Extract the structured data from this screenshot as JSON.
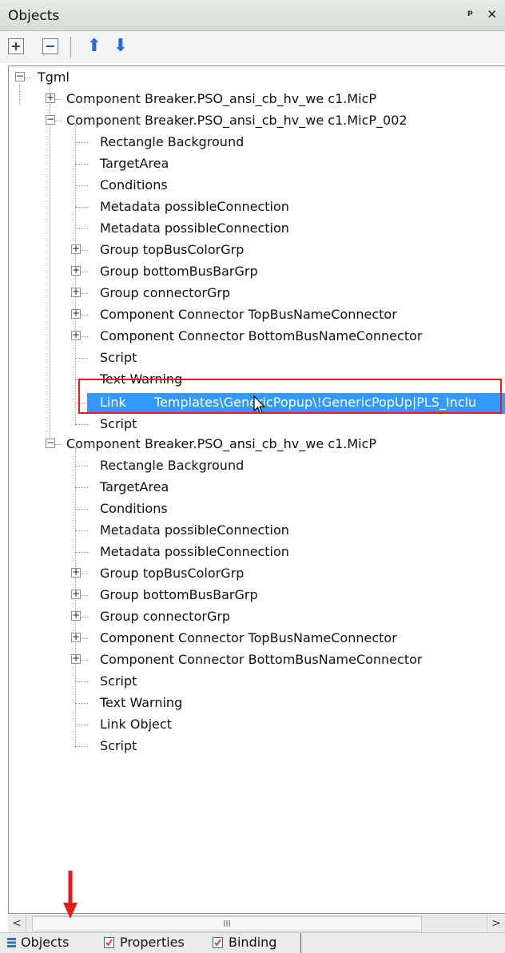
{
  "panel": {
    "title": "Objects",
    "buttons": "ᵖ ✕"
  },
  "toolbar": {
    "expand_all": "+",
    "collapse_all": "−",
    "move_up": "⬆",
    "move_down": "⬇"
  },
  "tree": {
    "root": "Tgml",
    "component1": "Component Breaker.PSO_ansi_cb_hv_we  c1.MicP",
    "component2": "Component Breaker.PSO_ansi_cb_hv_we  c1.MicP_002",
    "c2_items": [
      "Rectangle   Background",
      "TargetArea",
      "Conditions",
      "Metadata    possibleConnection",
      "Metadata    possibleConnection",
      "Group     topBusColorGrp",
      "Group     bottomBusBarGrp",
      "Group     connectorGrp",
      "Component Connector TopBusNameConnector",
      "Component Connector BottomBusNameConnector",
      "Script",
      "Text      Warning",
      "Link",
      "Script"
    ],
    "selected_link_path": "Templates\\GenericPopup\\!GenericPopUp|PLS_Inclu",
    "component3": "Component Breaker.PSO_ansi_cb_hv_we  c1.MicP",
    "c3_items": [
      "Rectangle   Background",
      "TargetArea",
      "Conditions",
      "Metadata    possibleConnection",
      "Metadata    possibleConnection",
      "Group     topBusColorGrp",
      "Group     bottomBusBarGrp",
      "Group     connectorGrp",
      "Component Connector TopBusNameConnector",
      "Component Connector BottomBusNameConnector",
      "Script",
      "Text    Warning",
      "Link    Object",
      "Script"
    ]
  },
  "scrollbar": {
    "left": "<",
    "thumb": "III",
    "right": ">"
  },
  "tabs": {
    "objects": "Objects",
    "properties": "Properties",
    "binding": "Binding"
  },
  "colors": {
    "selection": "#3399ff",
    "highlight_box": "#e51b1b",
    "annotation_arrow": "#e51b1b"
  }
}
